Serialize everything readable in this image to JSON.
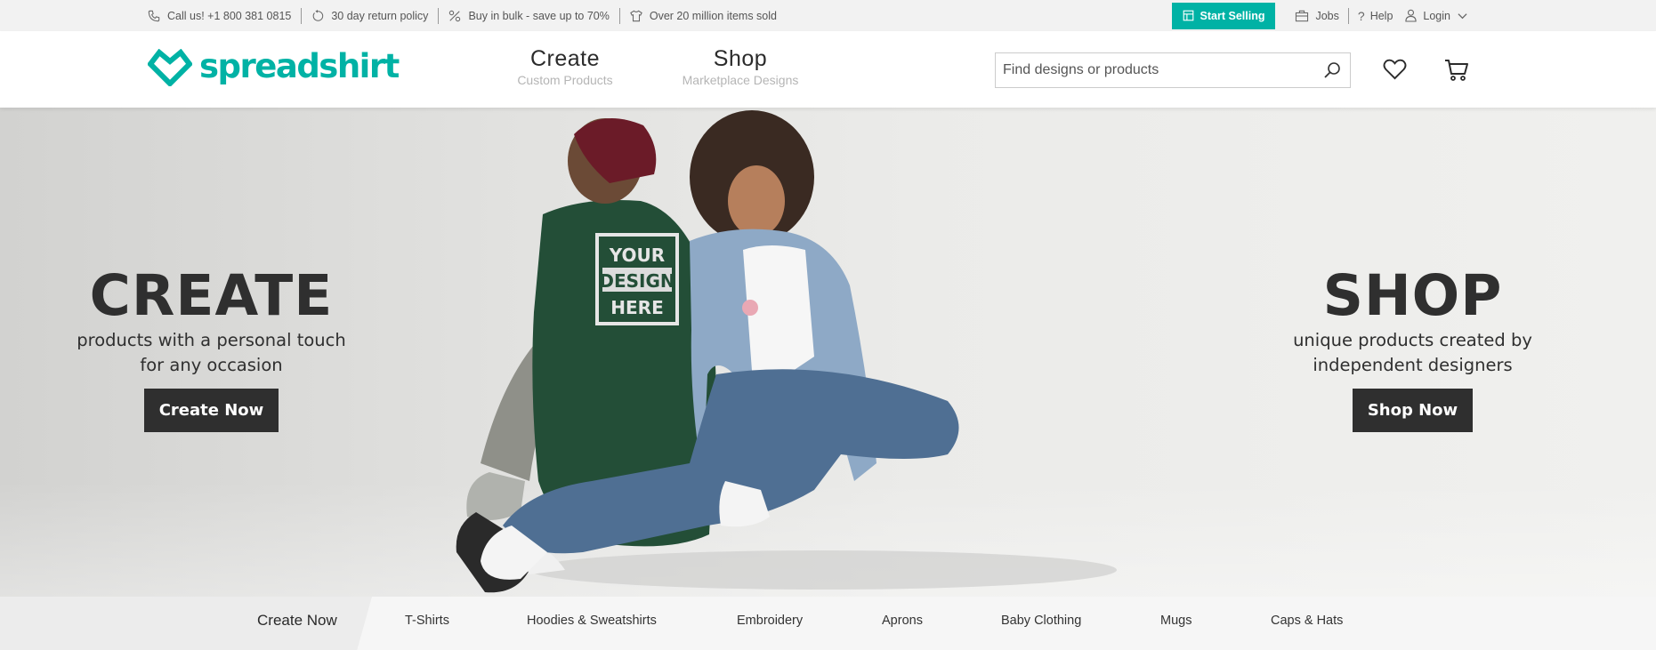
{
  "topbar": {
    "phone": "Call us! +1 800 381 0815",
    "returns": "30 day return policy",
    "bulk": "Buy in bulk - save up to 70%",
    "sold": "Over 20 million items sold",
    "start_selling": "Start Selling",
    "jobs": "Jobs",
    "help": "Help",
    "login": "Login"
  },
  "header": {
    "logo": "spreadshirt",
    "nav": [
      {
        "label": "Create",
        "sub": "Custom Products"
      },
      {
        "label": "Shop",
        "sub": "Marketplace Designs"
      }
    ],
    "search_placeholder": "Find designs or products"
  },
  "hero": {
    "left": {
      "title": "CREATE",
      "line1": "products with a personal touch",
      "line2": "for any occasion",
      "button": "Create Now"
    },
    "right": {
      "title": "SHOP",
      "line1": "unique products created by",
      "line2": "independent designers",
      "button": "Shop Now"
    },
    "shirt_print": [
      "YOUR",
      "DESIGN",
      "HERE"
    ]
  },
  "categories": {
    "lead": "Create Now",
    "items": [
      "T-Shirts",
      "Hoodies & Sweatshirts",
      "Embroidery",
      "Aprons",
      "Baby Clothing",
      "Mugs",
      "Caps & Hats"
    ]
  },
  "colors": {
    "brand": "#00b2a5",
    "button_dark": "#2f2f2f"
  }
}
